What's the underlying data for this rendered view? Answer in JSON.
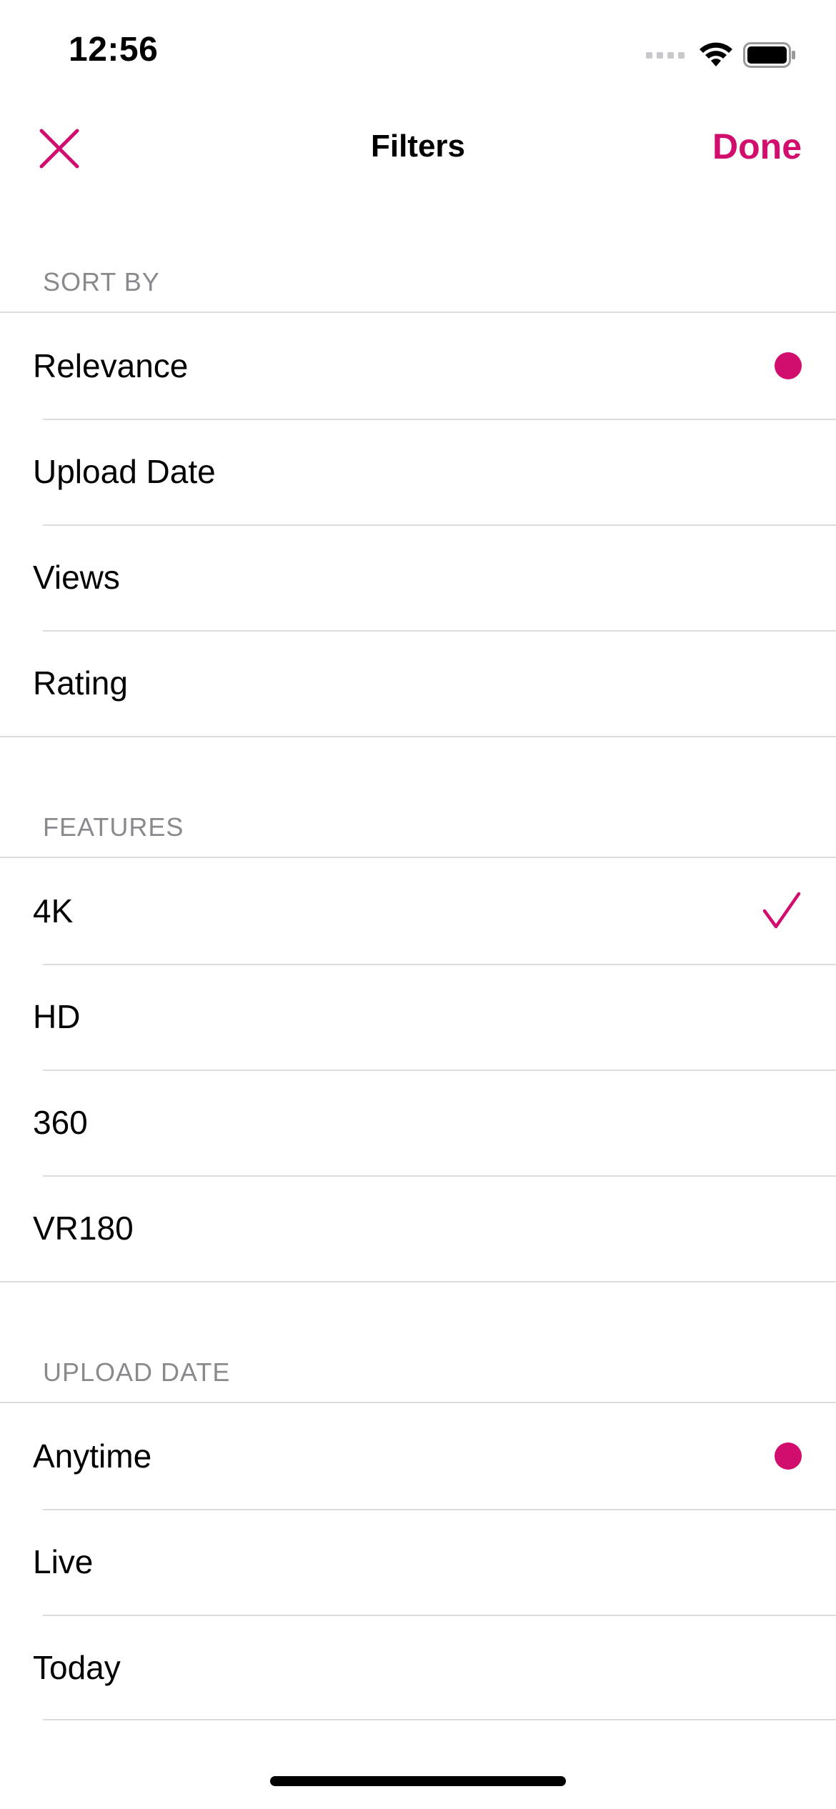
{
  "status_bar": {
    "time": "12:56",
    "icons": [
      "cellular-signal-icon",
      "wifi-icon",
      "battery-icon"
    ]
  },
  "nav": {
    "close_icon": "close-icon",
    "title": "Filters",
    "done_label": "Done"
  },
  "colors": {
    "accent": "#d10d6e",
    "section_text": "#8a8a8e",
    "separator": "#dcdcdc"
  },
  "sections": [
    {
      "header": "SORT BY",
      "items": [
        {
          "label": "Relevance",
          "selected": true,
          "indicator": "radio-dot-icon"
        },
        {
          "label": "Upload Date",
          "selected": false
        },
        {
          "label": "Views",
          "selected": false
        },
        {
          "label": "Rating",
          "selected": false
        }
      ]
    },
    {
      "header": "FEATURES",
      "items": [
        {
          "label": "4K",
          "selected": true,
          "indicator": "checkmark-icon"
        },
        {
          "label": "HD",
          "selected": false
        },
        {
          "label": "360",
          "selected": false
        },
        {
          "label": "VR180",
          "selected": false
        }
      ]
    },
    {
      "header": "UPLOAD DATE",
      "items": [
        {
          "label": "Anytime",
          "selected": true,
          "indicator": "radio-dot-icon"
        },
        {
          "label": "Live",
          "selected": false
        },
        {
          "label": "Today",
          "selected": false
        }
      ]
    }
  ]
}
